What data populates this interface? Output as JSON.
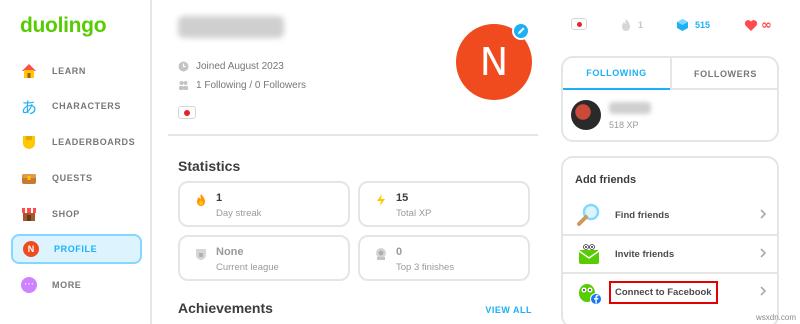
{
  "app": {
    "logo": "duolingo"
  },
  "sidebar": {
    "items": [
      {
        "label": "LEARN",
        "icon": "house-icon"
      },
      {
        "label": "CHARACTERS",
        "icon": "hiragana-icon",
        "glyph": "あ"
      },
      {
        "label": "LEADERBOARDS",
        "icon": "shield-icon"
      },
      {
        "label": "QUESTS",
        "icon": "treasure-chest-icon"
      },
      {
        "label": "SHOP",
        "icon": "shop-icon"
      },
      {
        "label": "PROFILE",
        "icon": "avatar-icon",
        "avatar_letter": "N",
        "active": true
      },
      {
        "label": "MORE",
        "icon": "more-icon",
        "glyph": "⋯"
      }
    ]
  },
  "profile": {
    "joined": "Joined August 2023",
    "follow_counts": "1 Following / 0 Followers",
    "avatar_letter": "N"
  },
  "statistics": {
    "title": "Statistics",
    "cards": [
      {
        "value": "1",
        "label": "Day streak",
        "icon": "flame-icon"
      },
      {
        "value": "15",
        "label": "Total XP",
        "icon": "lightning-icon"
      },
      {
        "value": "None",
        "label": "Current league",
        "icon": "league-lock-icon"
      },
      {
        "value": "0",
        "label": "Top 3 finishes",
        "icon": "medal-icon"
      }
    ]
  },
  "achievements": {
    "title": "Achievements",
    "view_all": "VIEW ALL"
  },
  "topbar": {
    "streak": "1",
    "gems": "515",
    "hearts": "∞"
  },
  "follow_panel": {
    "tabs": [
      "FOLLOWING",
      "FOLLOWERS"
    ],
    "friend_xp": "518 XP"
  },
  "add_friends": {
    "title": "Add friends",
    "rows": [
      {
        "label": "Find friends",
        "icon": "magnifier-icon"
      },
      {
        "label": "Invite friends",
        "icon": "mail-owl-icon"
      },
      {
        "label": "Connect to Facebook",
        "icon": "facebook-owl-icon"
      }
    ]
  },
  "watermark": "wsxdn.com",
  "colors": {
    "brand": "#58cc02",
    "accent": "#1cb0f6",
    "avatar": "#f04b1e",
    "highlight": "#e30000"
  }
}
